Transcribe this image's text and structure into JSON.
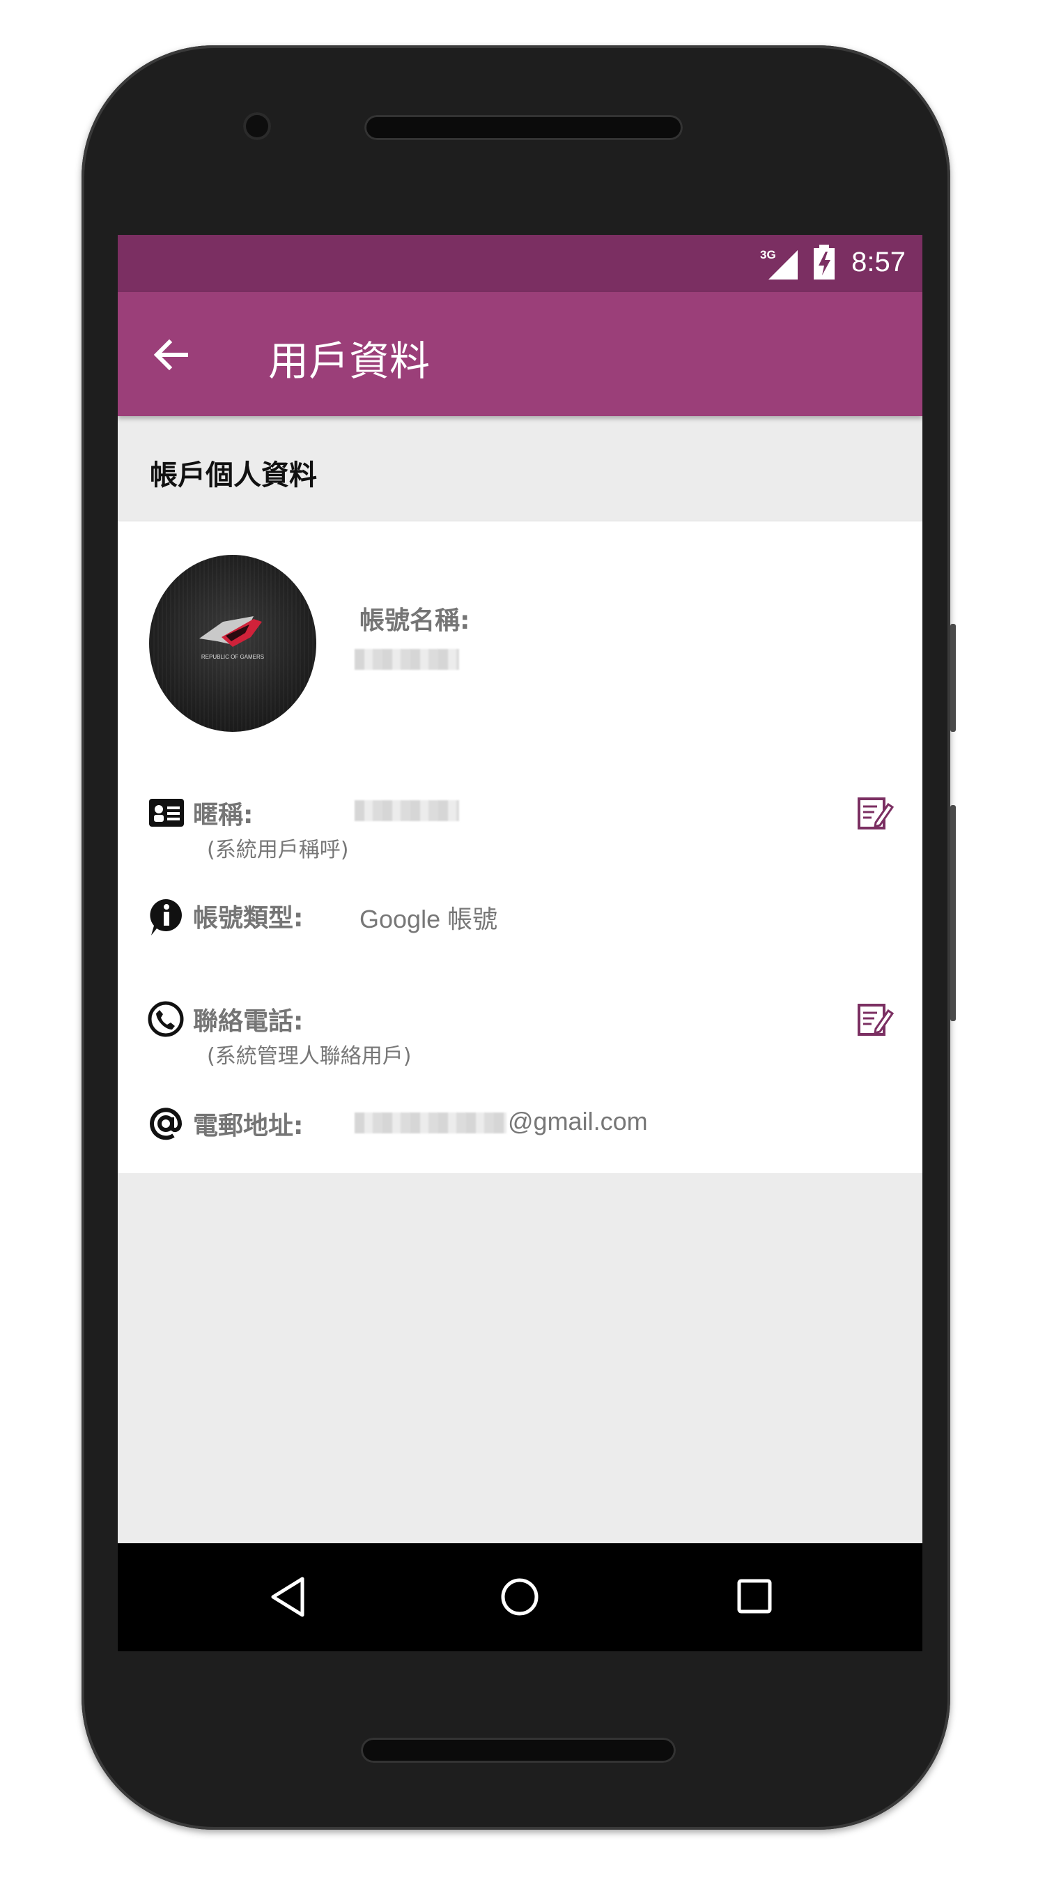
{
  "status_bar": {
    "network": "3G",
    "time": "8:57"
  },
  "app_bar": {
    "title": "用戶資料"
  },
  "section": {
    "title": "帳戶個人資料"
  },
  "profile": {
    "avatar_text": "REPUBLIC OF GAMERS",
    "account_name_label": "帳號名稱:",
    "nickname_label": "暱稱:",
    "nickname_note": "(系統用戶稱呼)",
    "account_type_label": "帳號類型:",
    "account_type_value": "Google 帳號",
    "phone_label": "聯絡電話:",
    "phone_note": "(系統管理人聯絡用戶)",
    "email_label": "電郵地址:",
    "email_domain": "@gmail.com"
  },
  "colors": {
    "primary": "#9b3f79",
    "primary_dark": "#7b2f62",
    "icon_accent": "#7b2f62"
  },
  "icons": [
    "back-arrow",
    "id-card",
    "info",
    "phone",
    "at-sign",
    "edit",
    "nav-back",
    "nav-home",
    "nav-recents"
  ]
}
